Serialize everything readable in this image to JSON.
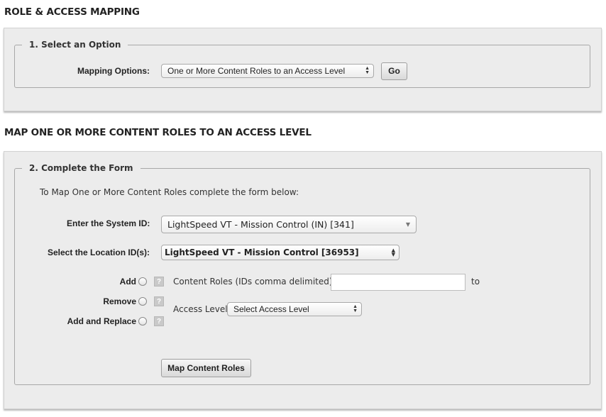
{
  "section1": {
    "title": "ROLE & ACCESS MAPPING",
    "legend": "1. Select an Option",
    "mapping_label": "Mapping Options:",
    "mapping_value": "One or More Content Roles to an Access Level",
    "go_label": "Go"
  },
  "section2": {
    "title": "MAP ONE OR MORE CONTENT ROLES TO AN ACCESS LEVEL",
    "legend": "2. Complete the Form",
    "instructions": "To Map One or More Content Roles complete the form below:",
    "system_label": "Enter the System ID:",
    "system_value": "LightSpeed VT - Mission Control (IN) [341]",
    "location_label": "Select the Location ID(s):",
    "location_value": "LightSpeed VT - Mission Control [36953]",
    "actions": [
      {
        "label": "Add"
      },
      {
        "label": "Remove"
      },
      {
        "label": "Add and Replace"
      }
    ],
    "help_glyph": "?",
    "content_roles_label": "Content Roles (IDs comma delimited)",
    "content_roles_value": "",
    "to_label": "to",
    "access_level_label": "Access Level",
    "access_level_value": "Select Access Level",
    "submit_label": "Map Content Roles"
  },
  "icons": {
    "select_arrows": "up-down-arrows-icon",
    "combo_arrow": "down-triangle-icon",
    "help": "question-mark-icon"
  }
}
